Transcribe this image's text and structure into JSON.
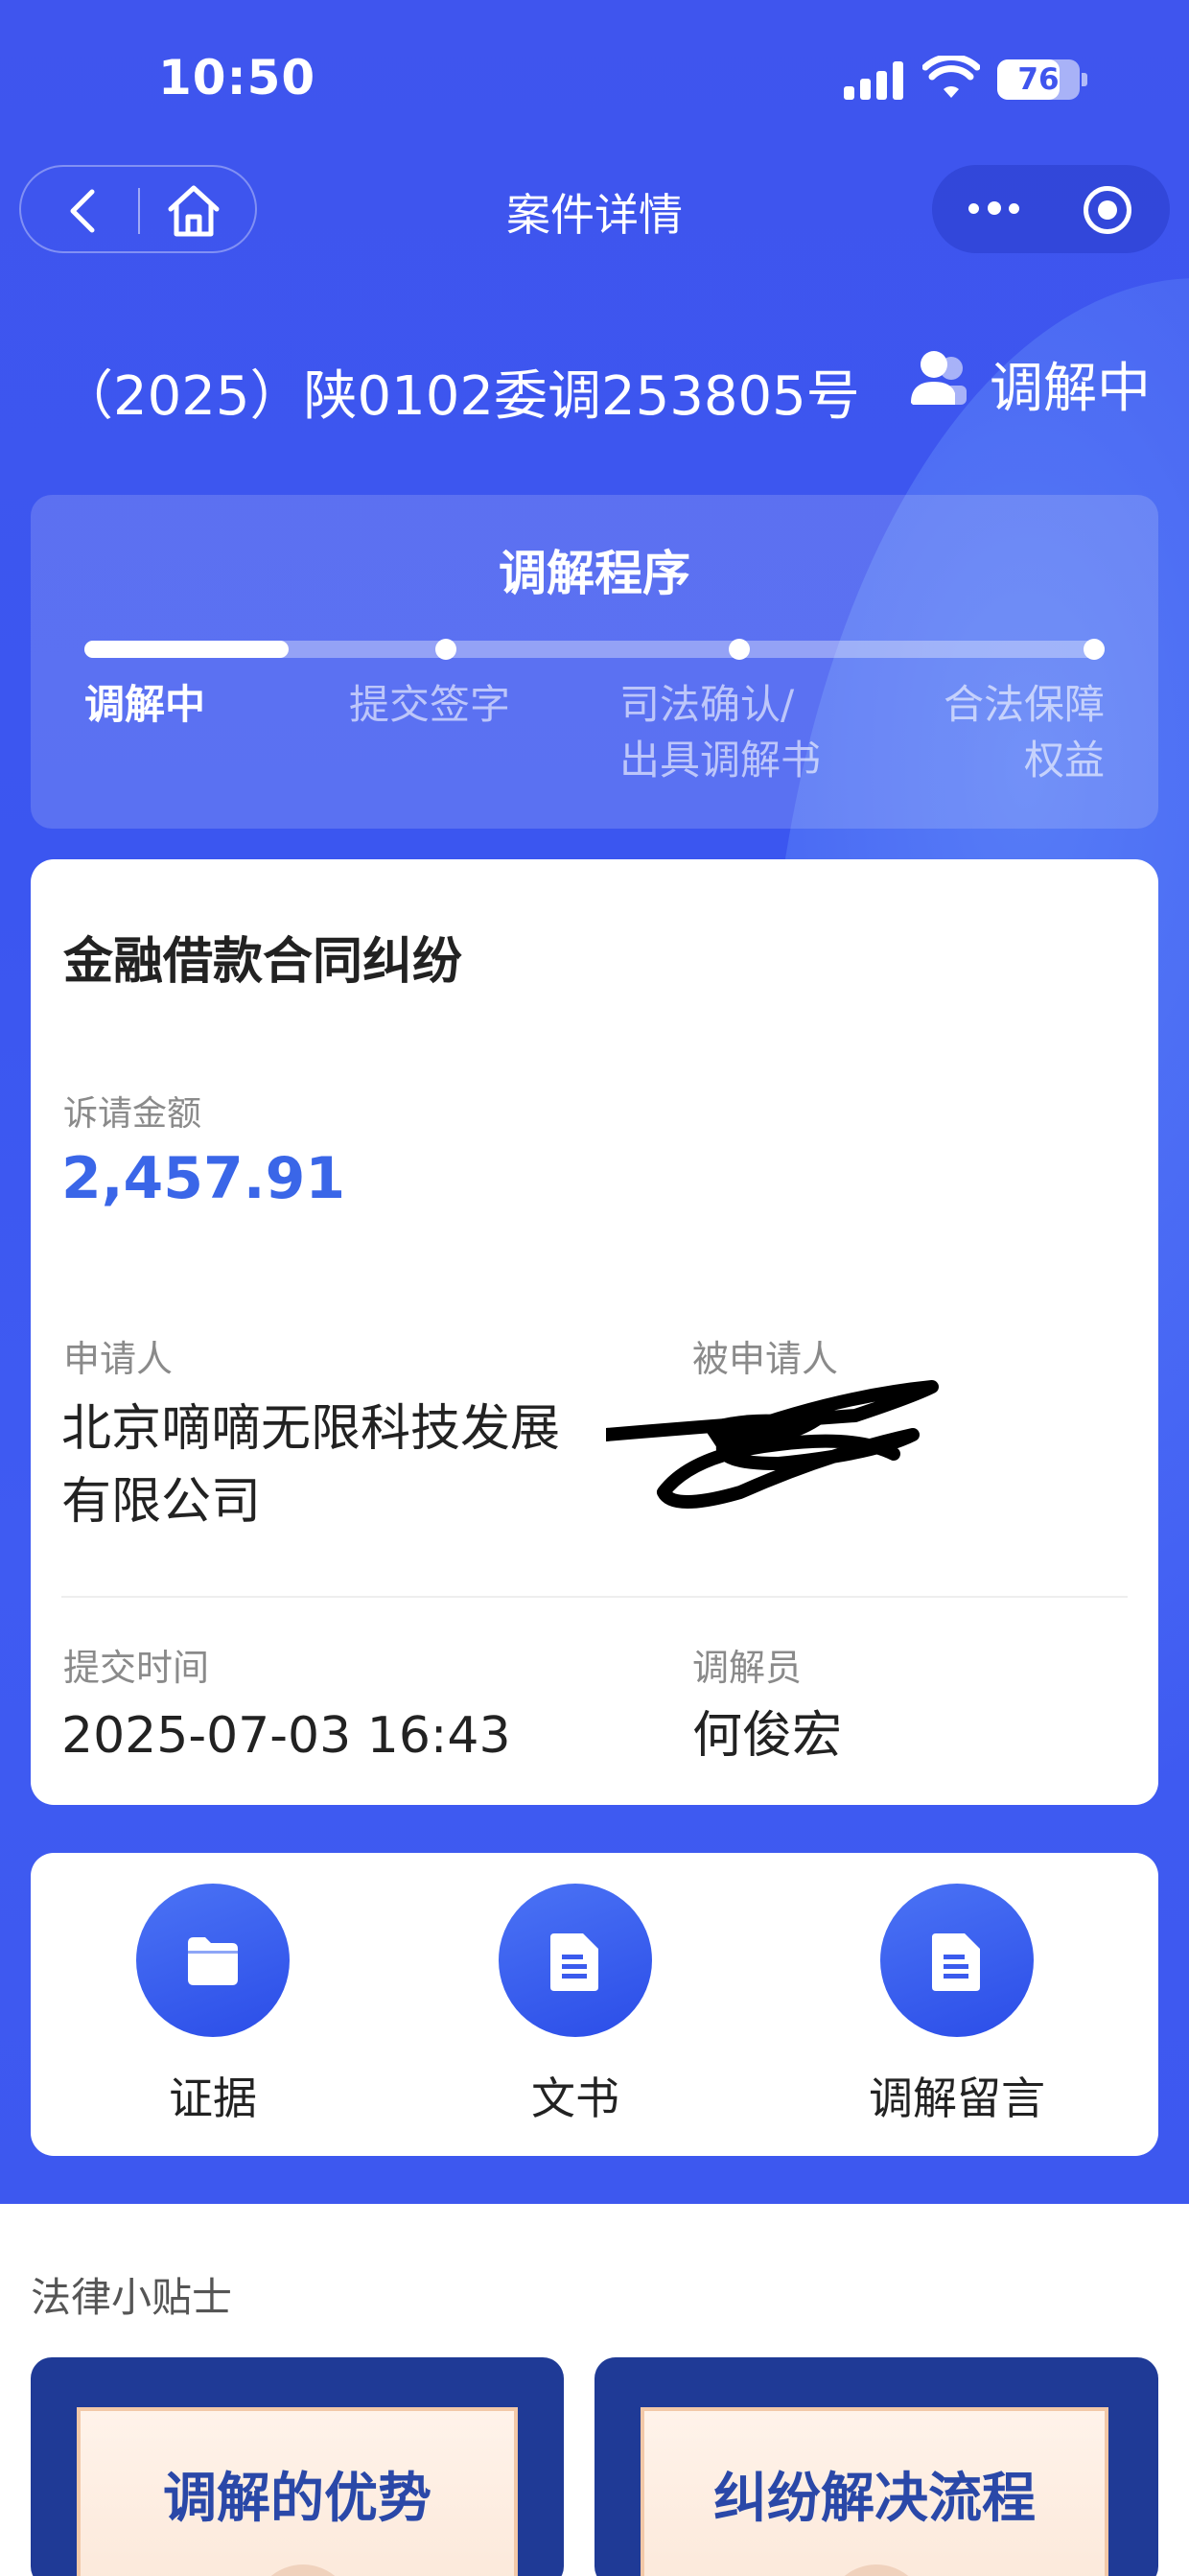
{
  "status_bar": {
    "time": "10:50",
    "battery": "76",
    "battery_level": 0.76
  },
  "nav": {
    "title": "案件详情"
  },
  "case": {
    "number": "（2025）陕0102委调253805号",
    "status": "调解中"
  },
  "process": {
    "title": "调解程序",
    "progress": 0.2,
    "steps": [
      {
        "line1": "调解中",
        "line2": ""
      },
      {
        "line1": "提交签字",
        "line2": ""
      },
      {
        "line1": "司法确认/",
        "line2": "出具调解书"
      },
      {
        "line1": "合法保障",
        "line2": "权益"
      }
    ]
  },
  "info": {
    "case_type": "金融借款合同纠纷",
    "amount_label": "诉请金额",
    "amount": "2,457.91",
    "applicant_label": "申请人",
    "applicant_line1": "北京嘀嘀无限科技发展",
    "applicant_line2": "有限公司",
    "respondent_label": "被申请人",
    "submit_time_label": "提交时间",
    "submit_time": "2025-07-03 16:43",
    "mediator_label": "调解员",
    "mediator": "何俊宏"
  },
  "actions": [
    {
      "label": "证据",
      "icon": "folder-icon"
    },
    {
      "label": "文书",
      "icon": "document-icon"
    },
    {
      "label": "调解留言",
      "icon": "document-icon"
    }
  ],
  "tips": {
    "title": "法律小贴士",
    "cards": [
      "调解的优势",
      "纠纷解决流程"
    ]
  },
  "colors": {
    "primary": "#3f55ee",
    "accent": "#3a66e8"
  }
}
